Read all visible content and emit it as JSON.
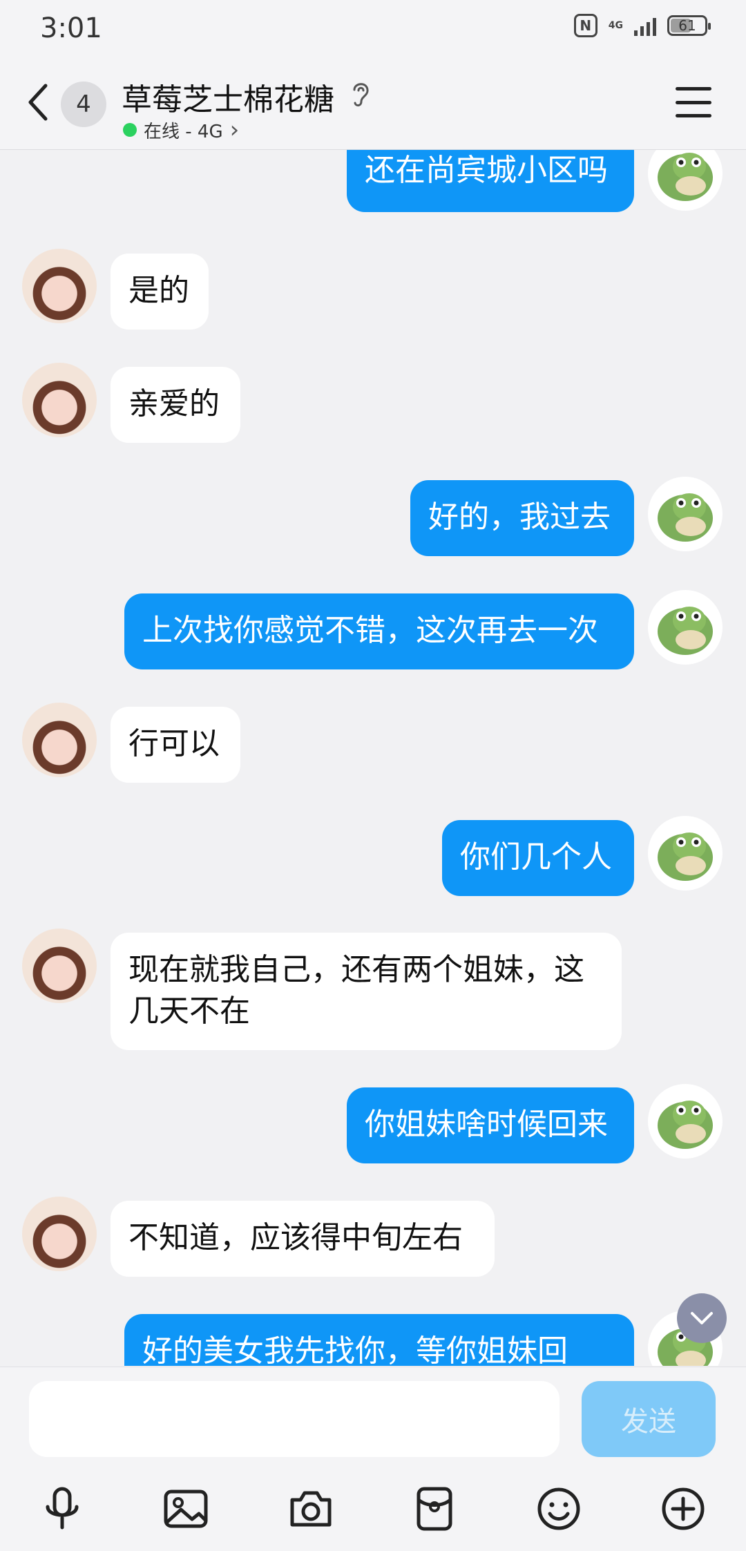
{
  "status_bar": {
    "time": "3:01",
    "network": "4G",
    "battery": "61",
    "battery_level": 0.61
  },
  "header": {
    "badge": "4",
    "title": "草莓芝士棉花糖",
    "subtitle": "在线 - 4G",
    "subtitle_chevron": "›"
  },
  "colors": {
    "accent": "#0f96f7",
    "online": "#2bd15f",
    "background": "#f1f1f3",
    "send_disabled": "#7fc9f8"
  },
  "messages": [
    {
      "from": "me",
      "text": "还在尚宾城小区吗"
    },
    {
      "from": "them",
      "text": "是的"
    },
    {
      "from": "them",
      "text": "亲爱的"
    },
    {
      "from": "me",
      "text": "好的，我过去"
    },
    {
      "from": "me",
      "text": "上次找你感觉不错，这次再去一次"
    },
    {
      "from": "them",
      "text": "行可以"
    },
    {
      "from": "me",
      "text": "你们几个人"
    },
    {
      "from": "them",
      "line1": "现在就我自己，还有两个姐妹，这",
      "line2": "几天不在"
    },
    {
      "from": "me",
      "text": "你姐妹啥时候回来"
    },
    {
      "from": "them",
      "text": "不知道，应该得中旬左右"
    },
    {
      "from": "me",
      "text": "好的美女我先找你，等你姐妹回"
    }
  ],
  "input": {
    "placeholder": "",
    "send_label": "发送"
  },
  "toolbar": [
    "microphone-icon",
    "image-icon",
    "camera-icon",
    "red-packet-icon",
    "emoji-icon",
    "plus-icon"
  ]
}
